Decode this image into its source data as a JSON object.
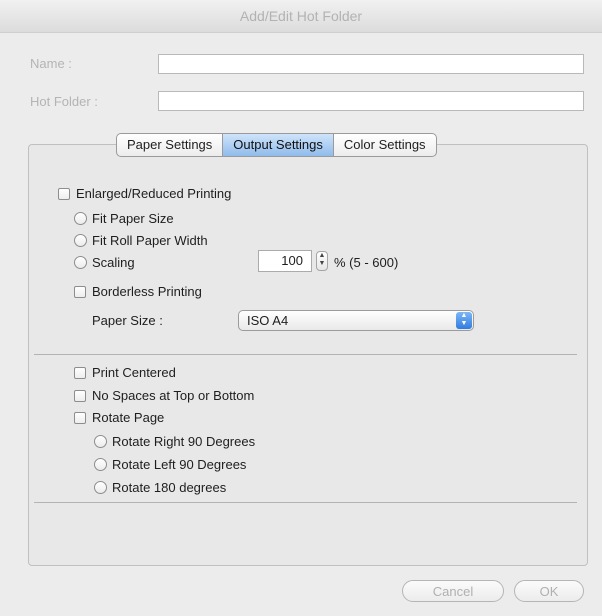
{
  "window": {
    "title": "Add/Edit Hot Folder"
  },
  "fields": {
    "name_label": "Name :",
    "name_value": "",
    "hotfolder_label": "Hot Folder :",
    "hotfolder_value": ""
  },
  "tabs": [
    {
      "label": "Paper Settings",
      "active": false
    },
    {
      "label": "Output Settings",
      "active": true
    },
    {
      "label": "Color Settings",
      "active": false
    }
  ],
  "output": {
    "enlarged_label": "Enlarged/Reduced Printing",
    "fit_paper_label": "Fit Paper Size",
    "fit_roll_label": "Fit Roll Paper Width",
    "scaling_label": "Scaling",
    "scaling_value": "100",
    "scaling_range": "% (5 - 600)",
    "borderless_label": "Borderless Printing",
    "paper_size_label": "Paper Size :",
    "paper_size_value": "ISO A4",
    "print_centered_label": "Print Centered",
    "no_spaces_label": "No Spaces at Top or Bottom",
    "rotate_page_label": "Rotate Page",
    "rotate_right_label": "Rotate Right 90 Degrees",
    "rotate_left_label": "Rotate Left 90 Degrees",
    "rotate_180_label": "Rotate 180 degrees"
  },
  "buttons": {
    "cancel": "Cancel",
    "ok": "OK"
  },
  "icons": {
    "stepper": "stepper-arrows-icon",
    "popup": "popup-arrows-icon"
  }
}
